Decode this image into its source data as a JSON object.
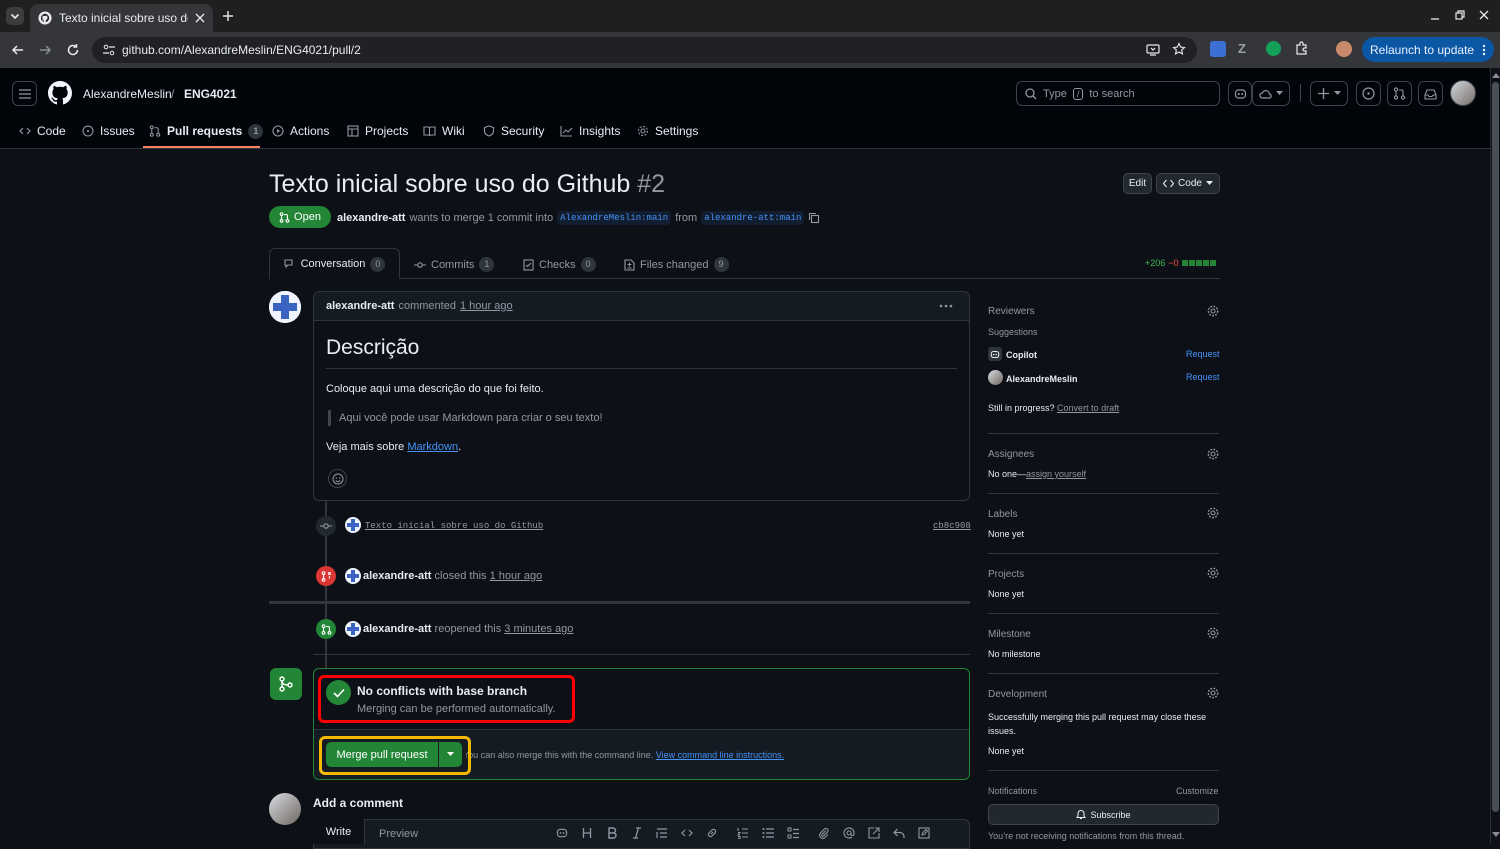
{
  "browser": {
    "tab_title": "Texto inicial sobre uso do Github",
    "url": "github.com/AlexandreMeslin/ENG4021/pull/2",
    "relaunch": "Relaunch to update"
  },
  "header": {
    "owner": "AlexandreMeslin",
    "sep": "/",
    "repo": "ENG4021",
    "search_prefix": "Type",
    "search_key": "/",
    "search_suffix": "to search"
  },
  "repo_nav": [
    {
      "label": "Code"
    },
    {
      "label": "Issues"
    },
    {
      "label": "Pull requests",
      "count": "1"
    },
    {
      "label": "Actions"
    },
    {
      "label": "Projects"
    },
    {
      "label": "Wiki"
    },
    {
      "label": "Security"
    },
    {
      "label": "Insights"
    },
    {
      "label": "Settings"
    }
  ],
  "pr": {
    "title": "Texto inicial sobre uso do Github",
    "number": "#2",
    "state": "Open",
    "author": "alexandre-att",
    "merge_text": "wants to merge 1 commit into",
    "base": "AlexandreMeslin:main",
    "from": "from",
    "head": "alexandre-att:main",
    "edit": "Edit",
    "code": "Code",
    "diff_add": "+206",
    "diff_del": "−0"
  },
  "tabs": [
    {
      "label": "Conversation",
      "count": "0"
    },
    {
      "label": "Commits",
      "count": "1"
    },
    {
      "label": "Checks",
      "count": "0"
    },
    {
      "label": "Files changed",
      "count": "9"
    }
  ],
  "comment": {
    "author": "alexandre-att",
    "action": "commented",
    "time": "1 hour ago",
    "heading": "Descrição",
    "p1": "Coloque aqui uma descrição do que foi feito.",
    "quote": "Aqui você pode usar Markdown para criar o seu texto!",
    "p2_prefix": "Veja mais sobre",
    "p2_link": "Markdown",
    "p2_suffix": "."
  },
  "timeline": {
    "commit_msg": "Texto inicial sobre uso do Github",
    "commit_sha": "cb8c908",
    "closed_user": "alexandre-att",
    "closed_text": "closed this",
    "closed_time": "1 hour ago",
    "reopened_user": "alexandre-att",
    "reopened_text": "reopened this",
    "reopened_time": "3 minutes ago"
  },
  "merge": {
    "title": "No conflicts with base branch",
    "subtitle": "Merging can be performed automatically.",
    "button": "Merge pull request",
    "hint": "You can also merge this with the command line.",
    "hint_link": "View command line instructions."
  },
  "add_comment": {
    "title": "Add a comment",
    "write": "Write",
    "preview": "Preview"
  },
  "sidebar": {
    "reviewers": "Reviewers",
    "suggestions": "Suggestions",
    "sugg1": "Copilot",
    "sugg2": "AlexandreMeslin",
    "request": "Request",
    "still": "Still in progress?",
    "convert": "Convert to draft",
    "assignees": "Assignees",
    "assignees_val": "No one—",
    "assign_yourself": "assign yourself",
    "labels": "Labels",
    "labels_val": "None yet",
    "projects": "Projects",
    "projects_val": "None yet",
    "milestone": "Milestone",
    "milestone_val": "No milestone",
    "development": "Development",
    "development_text": "Successfully merging this pull request may close these issues.",
    "development_val": "None yet",
    "notifications": "Notifications",
    "customize": "Customize",
    "subscribe": "Subscribe",
    "notif_text": "You’re not receiving notifications from this thread."
  },
  "colors": {
    "green": "#238636",
    "open_badge": "#238636",
    "link": "#4493f8",
    "closed": "#da3633",
    "highlight_red": "#ff0000",
    "highlight_yellow": "#f5b800"
  }
}
